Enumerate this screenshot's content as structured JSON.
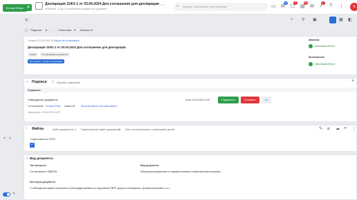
{
  "header": {
    "user_chip": "Котова Юлия",
    "close_glyph": "✕",
    "title": "Декларация 154/1-1 от 03.04.2024 Доп.соглашение для декларации",
    "subtitle": "#3403488  ·  СЭД | Согласование документов | Документ",
    "search_placeholder": "Задачи, сообщения, пространства",
    "badges": [
      "54",
      "5",
      "42",
      "2"
    ],
    "avatar_initial": "К"
  },
  "toolbar": {
    "signers": "Подписи",
    "participants": "Участники",
    "more": "Больше"
  },
  "document": {
    "created_label": "Создано 03.04.2024 16:09",
    "deadline_label": "Срок (не установлен)",
    "heading": "Декларация 154/1-1 от 03.04.2024 Доп.соглашение для декларации",
    "tags": [
      "Новая",
      "Согласование документов"
    ],
    "stage_tag": "На подписи - Требует подписания",
    "customer_label": "Заказчик",
    "customer_name": "Николаева Олеся",
    "executor_label": "Исполнитель",
    "executor_name": "Николаева Олеся"
  },
  "signatures": {
    "title": "Подписи",
    "journal_link": "Журнал подписей",
    "column_header": "Подписант",
    "row_title": "Утверждение документа",
    "coordination_label": "Согласование:",
    "coordination_person": "Котова Юлия",
    "deputy_label": "Заместит:",
    "deputy_people": "Волкова Ирина, Волкова Ирина",
    "requested": "Запрошено: 19.04.2023 11:57",
    "deadline": "Срок 22.04.2023 11:57",
    "sign_button": "Подписать",
    "decline_button": "Отказать",
    "more_button": "•••"
  },
  "files": {
    "title": "Файлы",
    "tabs": [
      "Файл документа",
      "Подписанный файл документа",
      "Лист согласования с компанией детей"
    ],
    "tab_counts": [
      "1",
      "1"
    ],
    "ukep_label": "Подписывается УКЭП"
  },
  "doc_type": {
    "title": "Вид документа",
    "process_label": "Тип процесса",
    "process_value": "Согласование ОРД/ПНА",
    "kind_label": "Вид документа",
    "kind_value": "Приказы/распоряжения по административно-хозяйственным вопросам",
    "category_label": "Категория документа",
    "category_value": "О соблюдении правил внутреннего распорядка времени (о нарушении ПВТР, допуск в помещения, пропускной режим и т.п.)"
  },
  "colors": {
    "green": "#2e9e4a",
    "red": "#e0353b",
    "blue": "#2d6fd6"
  }
}
